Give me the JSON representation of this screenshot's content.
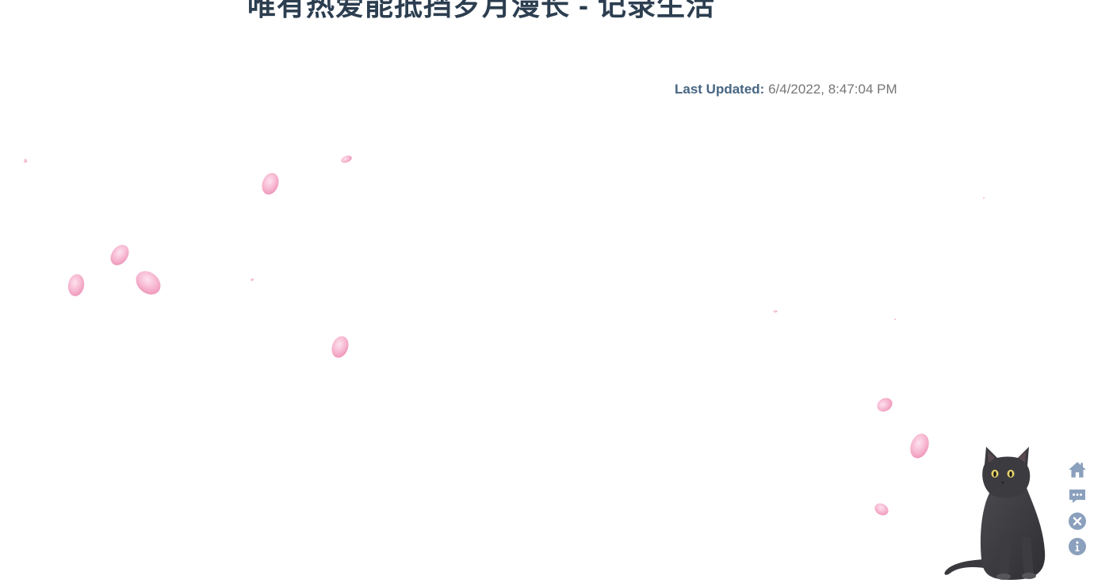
{
  "article": {
    "title": "唯有热爱能抵挡岁月漫长 - 记录生活"
  },
  "meta": {
    "last_updated_label": "Last Updated:",
    "last_updated_value": "6/4/2022, 8:47:04 PM"
  },
  "effects": {
    "petal_color": "#f4a6c4",
    "petal_edge_color": "#e77fa8"
  },
  "live2d": {
    "mascot": "black-cat",
    "tools": [
      {
        "name": "home-icon",
        "icon": "home"
      },
      {
        "name": "chat-icon",
        "icon": "comment"
      },
      {
        "name": "close-icon",
        "icon": "close"
      },
      {
        "name": "info-icon",
        "icon": "info"
      }
    ],
    "tool_color": "#8aa0bd"
  }
}
